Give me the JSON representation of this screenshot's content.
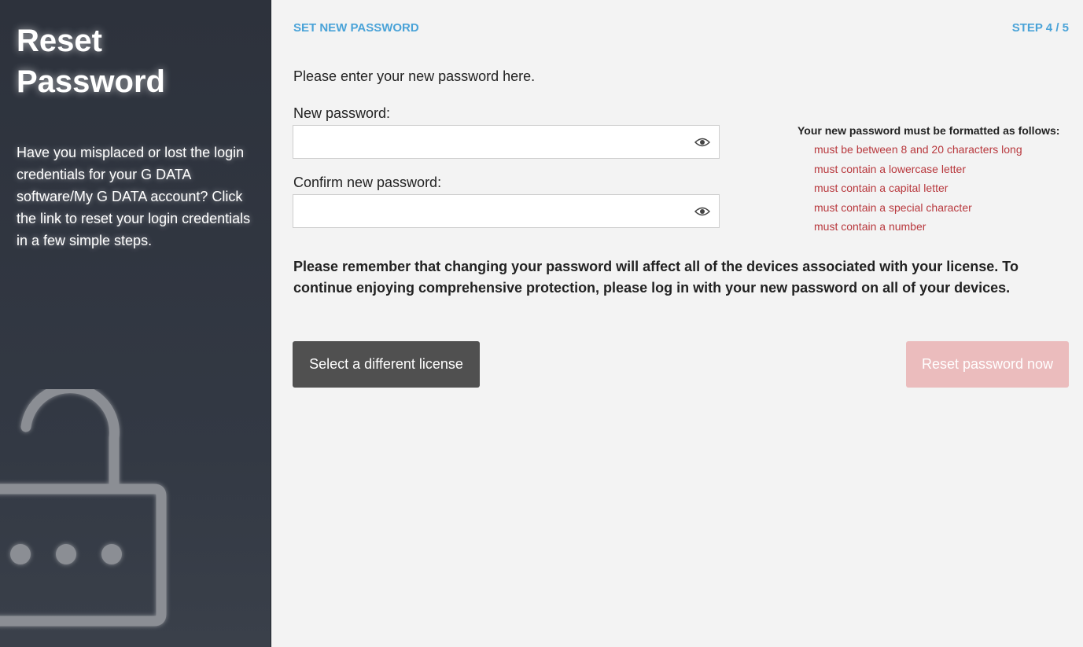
{
  "sidebar": {
    "title": "Reset Password",
    "description": "Have you misplaced or lost the login credentials for your G DATA software/My G DATA account? Click the link to reset your login credentials in a few simple steps."
  },
  "header": {
    "step_title": "SET NEW PASSWORD",
    "step_counter": "STEP 4 / 5"
  },
  "form": {
    "intro": "Please enter your new password here.",
    "new_password_label": "New password:",
    "new_password_value": "",
    "confirm_password_label": "Confirm new password:",
    "confirm_password_value": ""
  },
  "requirements": {
    "title": "Your new password must be formatted as follows:",
    "items": [
      "must be between 8 and 20 characters long",
      "must contain a lowercase letter",
      "must contain a capital letter",
      "must contain a special character",
      "must contain a number"
    ]
  },
  "notice": "Please remember that changing your password will affect all of the devices associated with your license. To continue enjoying comprehensive protection, please log in with your new password on all of your devices.",
  "buttons": {
    "select_license": "Select a different license",
    "reset_now": "Reset password now"
  },
  "colors": {
    "accent": "#4aa3d8",
    "requirement_text": "#b8383d",
    "disabled_primary": "#ebbcbd",
    "secondary_button": "#505050",
    "sidebar_bg": "#2d323c"
  },
  "icons": {
    "password_visibility": "eye-icon",
    "sidebar_illustration": "padlock-icon"
  }
}
